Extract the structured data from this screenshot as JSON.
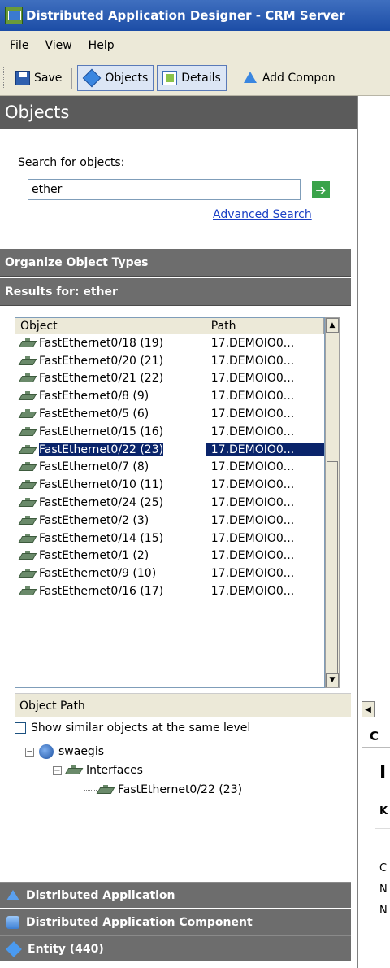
{
  "window": {
    "title": "Distributed Application Designer - CRM Server"
  },
  "menu": [
    "File",
    "View",
    "Help"
  ],
  "toolbar": {
    "save": "Save",
    "objects": "Objects",
    "details": "Details",
    "add_component": "Add Compon"
  },
  "objects_panel": {
    "title": "Objects",
    "search_label": "Search for objects:",
    "search_value": "ether",
    "advanced_search": "Advanced Search",
    "organize": "Organize Object Types",
    "results_for": "Results for: ether",
    "columns": {
      "object": "Object",
      "path": "Path"
    },
    "rows": [
      {
        "object": "FastEthernet0/18 (19)",
        "path": "17.DEMOIO0..."
      },
      {
        "object": "FastEthernet0/20 (21)",
        "path": "17.DEMOIO0..."
      },
      {
        "object": "FastEthernet0/21 (22)",
        "path": "17.DEMOIO0..."
      },
      {
        "object": "FastEthernet0/8 (9)",
        "path": "17.DEMOIO0..."
      },
      {
        "object": "FastEthernet0/5 (6)",
        "path": "17.DEMOIO0..."
      },
      {
        "object": "FastEthernet0/15 (16)",
        "path": "17.DEMOIO0..."
      },
      {
        "object": "FastEthernet0/22 (23)",
        "path": "17.DEMOIO0...",
        "selected": true
      },
      {
        "object": "FastEthernet0/7 (8)",
        "path": "17.DEMOIO0..."
      },
      {
        "object": "FastEthernet0/10 (11)",
        "path": "17.DEMOIO0..."
      },
      {
        "object": "FastEthernet0/24 (25)",
        "path": "17.DEMOIO0..."
      },
      {
        "object": "FastEthernet0/2 (3)",
        "path": "17.DEMOIO0..."
      },
      {
        "object": "FastEthernet0/14 (15)",
        "path": "17.DEMOIO0..."
      },
      {
        "object": "FastEthernet0/1 (2)",
        "path": "17.DEMOIO0..."
      },
      {
        "object": "FastEthernet0/9 (10)",
        "path": "17.DEMOIO0..."
      },
      {
        "object": "FastEthernet0/16 (17)",
        "path": "17.DEMOIO0..."
      }
    ],
    "object_path": {
      "title": "Object Path",
      "show_similar": "Show similar objects at the same level",
      "tree": {
        "root": "swaegis",
        "child": "Interfaces",
        "leaf": "FastEthernet0/22 (23)"
      }
    },
    "wunderbar": [
      {
        "label": "Distributed Application",
        "icon": "triangle-icon"
      },
      {
        "label": "Distributed Application Component",
        "icon": "component-icon"
      },
      {
        "label": "Entity (440)",
        "icon": "diamond-icon"
      }
    ]
  },
  "right_pane": {
    "tab_letter": "C",
    "heading_letter": "I",
    "key_letter": "K",
    "lines": [
      "C",
      "N",
      "N"
    ]
  }
}
